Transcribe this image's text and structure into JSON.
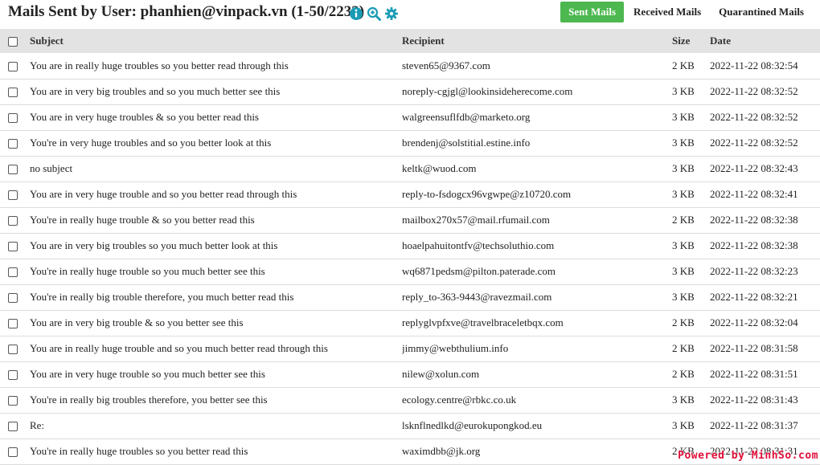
{
  "header": {
    "title": "Mails Sent by User: phanhien@vinpack.vn (1-50/2233)",
    "icons": [
      "info-icon",
      "zoom-in-icon",
      "gear-icon"
    ],
    "accent_color": "#1a9bb5"
  },
  "tabs": [
    {
      "label": "Sent Mails",
      "active": true,
      "color": "#4cb84f"
    },
    {
      "label": "Received Mails",
      "active": false
    },
    {
      "label": "Quarantined Mails",
      "active": false
    }
  ],
  "table": {
    "columns": [
      "Subject",
      "Recipient",
      "Size",
      "Date"
    ],
    "rows": [
      {
        "subject": "You are in really huge troubles so you better read through this",
        "recipient": "steven65@9367.com",
        "size": "2 KB",
        "date": "2022-11-22 08:32:54"
      },
      {
        "subject": "You are in very big troubles and so you much better see this",
        "recipient": "noreply-cgjgl@lookinsideherecome.com",
        "size": "3 KB",
        "date": "2022-11-22 08:32:52"
      },
      {
        "subject": "You are in very huge troubles & so you better read this",
        "recipient": "walgreensuflfdb@marketo.org",
        "size": "3 KB",
        "date": "2022-11-22 08:32:52"
      },
      {
        "subject": "You're in very huge troubles and so you better look at this",
        "recipient": "brendenj@solstitial.estine.info",
        "size": "3 KB",
        "date": "2022-11-22 08:32:52"
      },
      {
        "subject": "no subject",
        "recipient": "keltk@wuod.com",
        "size": "3 KB",
        "date": "2022-11-22 08:32:43"
      },
      {
        "subject": "You are in very huge trouble and so you better read through this",
        "recipient": "reply-to-fsdogcx96vgwpe@z10720.com",
        "size": "3 KB",
        "date": "2022-11-22 08:32:41"
      },
      {
        "subject": "You're in really huge trouble & so you better read this",
        "recipient": "mailbox270x57@mail.rfumail.com",
        "size": "2 KB",
        "date": "2022-11-22 08:32:38"
      },
      {
        "subject": "You are in very big troubles so you much better look at this",
        "recipient": "hoaelpahuitontfv@techsoluthio.com",
        "size": "3 KB",
        "date": "2022-11-22 08:32:38"
      },
      {
        "subject": "You're in really huge trouble so you much better see this",
        "recipient": "wq6871pedsm@pilton.paterade.com",
        "size": "3 KB",
        "date": "2022-11-22 08:32:23"
      },
      {
        "subject": "You're in really big trouble therefore, you much better read this",
        "recipient": "reply_to-363-9443@ravezmail.com",
        "size": "3 KB",
        "date": "2022-11-22 08:32:21"
      },
      {
        "subject": "You are in very big trouble & so you better see this",
        "recipient": "replyglvpfxve@travelbraceletbqx.com",
        "size": "2 KB",
        "date": "2022-11-22 08:32:04"
      },
      {
        "subject": "You are in really huge trouble and so you much better read through this",
        "recipient": "jimmy@webthulium.info",
        "size": "2 KB",
        "date": "2022-11-22 08:31:58"
      },
      {
        "subject": "You are in very huge trouble so you much better see this",
        "recipient": "nilew@xolun.com",
        "size": "2 KB",
        "date": "2022-11-22 08:31:51"
      },
      {
        "subject": "You're in really big troubles therefore, you better see this",
        "recipient": "ecology.centre@rbkc.co.uk",
        "size": "3 KB",
        "date": "2022-11-22 08:31:43"
      },
      {
        "subject": "Re:",
        "recipient": "lsknflnedlkd@eurokupongkod.eu",
        "size": "3 KB",
        "date": "2022-11-22 08:31:37"
      },
      {
        "subject": "You're in really huge troubles so you better read this",
        "recipient": "waximdbb@jk.org",
        "size": "2 KB",
        "date": "2022-11-22 08:31:31"
      }
    ]
  },
  "watermark": "Powered by MinhSo.com"
}
